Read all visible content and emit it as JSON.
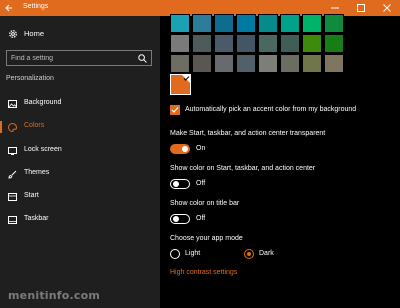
{
  "window": {
    "title": "Settings"
  },
  "sidebar": {
    "home_label": "Home",
    "search_placeholder": "Find a setting",
    "section_label": "Personalization",
    "items": [
      {
        "label": "Background",
        "icon": "image-icon"
      },
      {
        "label": "Colors",
        "icon": "palette-icon",
        "active": true
      },
      {
        "label": "Lock screen",
        "icon": "lock-screen-icon"
      },
      {
        "label": "Themes",
        "icon": "brush-icon"
      },
      {
        "label": "Start",
        "icon": "start-icon"
      },
      {
        "label": "Taskbar",
        "icon": "taskbar-icon"
      }
    ]
  },
  "colors": {
    "accent": "#e06a1d",
    "palette_rows": [
      [
        "#1ba1b5",
        "#2d7d9a",
        "#0e6d8e",
        "#0079a3",
        "#088a8a",
        "#00a389",
        "#00b36b",
        "#108a3c"
      ],
      [
        "#7a7a7a",
        "#4f5a5a",
        "#4a5a68",
        "#425664",
        "#486860",
        "#3f5e57",
        "#3e8a0c",
        "#177d17"
      ],
      [
        "#6e6d63",
        "#5a5753",
        "#676b6f",
        "#52606a",
        "#7b7f77",
        "#6a6e62",
        "#71764a",
        "#7e7660"
      ]
    ],
    "selected_color": "#e06a1d"
  },
  "main": {
    "auto_accent_label": "Automatically pick an accent color from my background",
    "transparent_label": "Make Start, taskbar, and action center transparent",
    "transparent_state": "On",
    "show_start_label": "Show color on Start, taskbar, and action center",
    "show_start_state": "Off",
    "show_titlebar_label": "Show color on title bar",
    "show_titlebar_state": "Off",
    "app_mode_label": "Choose your app mode",
    "light_label": "Light",
    "dark_label": "Dark",
    "high_contrast_link": "High contrast settings"
  },
  "watermark": "menitinfo.com"
}
